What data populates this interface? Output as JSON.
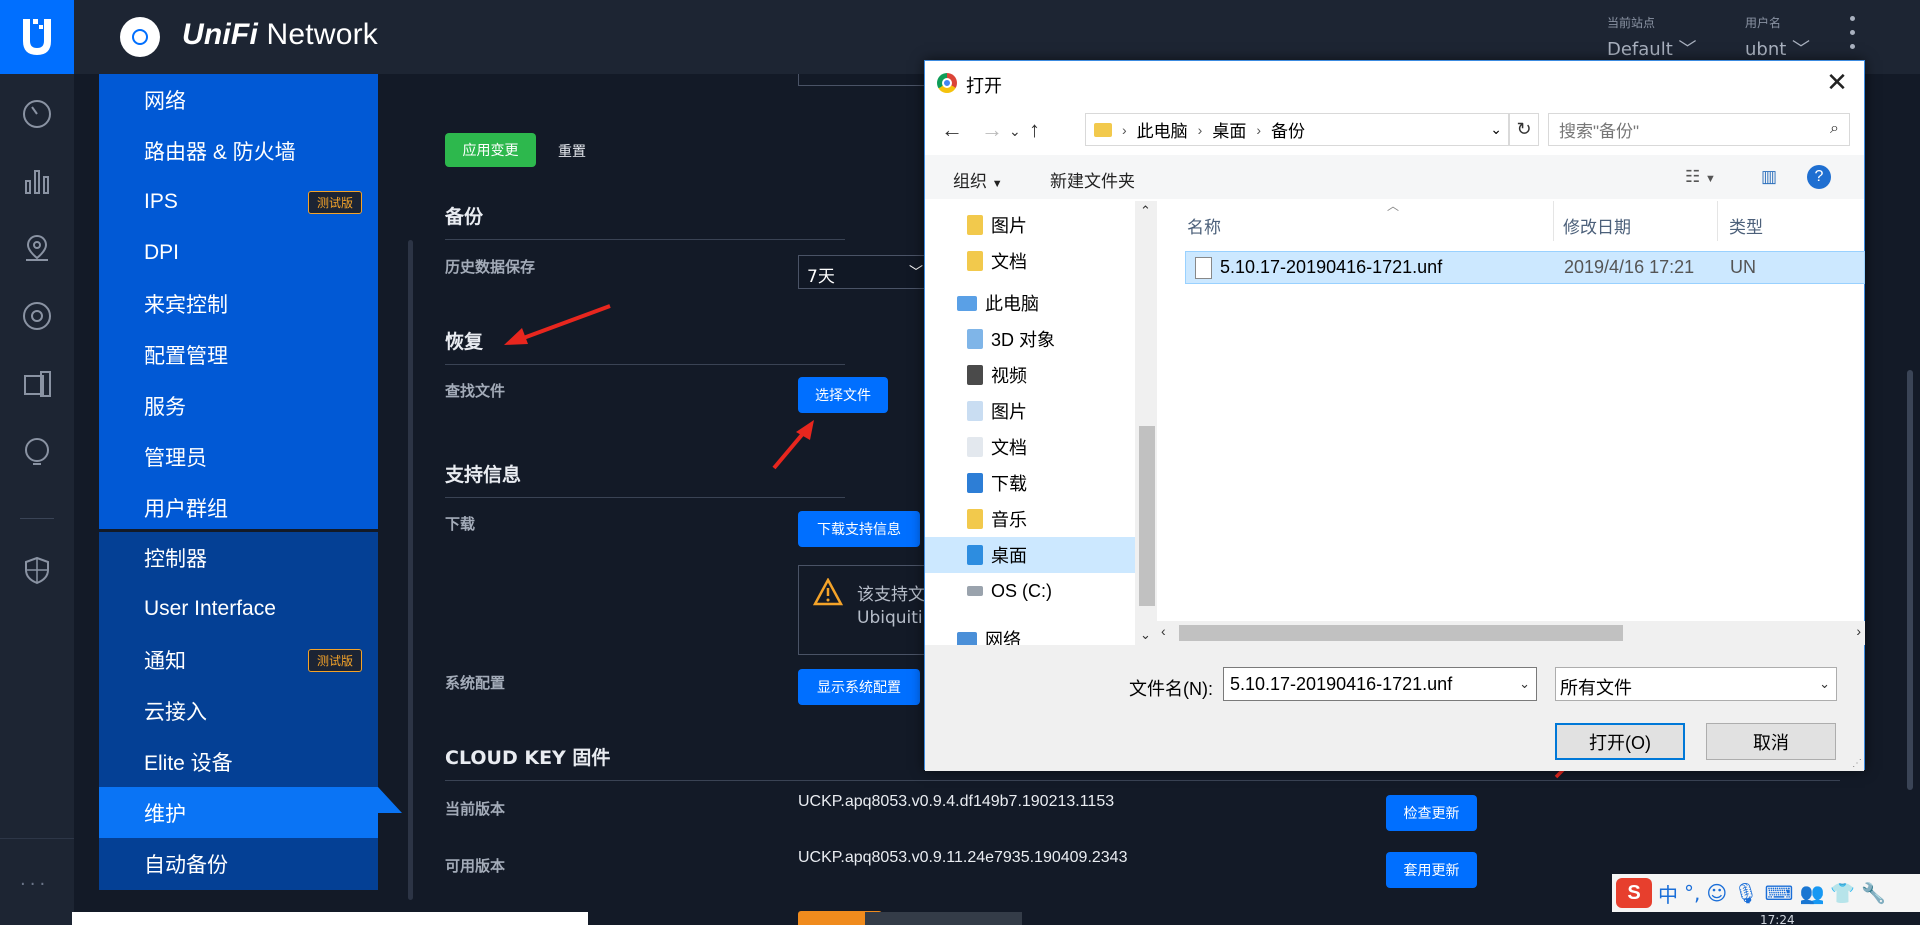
{
  "app": {
    "title_prefix": "UniFi",
    "title_suffix": "Network",
    "site_label": "当前站点",
    "site_value": "Default",
    "user_label": "用户名",
    "user_value": "ubnt"
  },
  "rail_icons": [
    "dashboard-icon",
    "statistics-icon",
    "map-icon",
    "devices-icon",
    "clients-icon",
    "insights-icon",
    "threat-management-icon"
  ],
  "sidenav": {
    "group1": [
      {
        "label": "网络"
      },
      {
        "label": "路由器 & 防火墙"
      },
      {
        "label": "IPS",
        "badge": "测试版"
      },
      {
        "label": "DPI"
      },
      {
        "label": "来宾控制"
      },
      {
        "label": "配置管理"
      },
      {
        "label": "服务"
      },
      {
        "label": "管理员"
      },
      {
        "label": "用户群组"
      }
    ],
    "group2": [
      {
        "label": "控制器"
      },
      {
        "label": "User Interface"
      },
      {
        "label": "通知",
        "badge": "测试版"
      },
      {
        "label": "云接入"
      },
      {
        "label": "Elite 设备"
      },
      {
        "label": "维护",
        "active": true
      },
      {
        "label": "自动备份"
      }
    ]
  },
  "main": {
    "apply_button": "应用变更",
    "reset_link": "重置",
    "backup_title": "备份",
    "history_label": "历史数据保存",
    "history_value": "7天",
    "restore_title": "恢复",
    "find_file_label": "查找文件",
    "choose_file_button": "选择文件",
    "support_title": "支持信息",
    "download_label": "下载",
    "download_button": "下载支持信息",
    "warning_line1": "该支持文",
    "warning_line2": "Ubiquiti",
    "sysconfig_label": "系统配置",
    "sysconfig_button": "显示系统配置",
    "cloudkey_title": "CLOUD KEY 固件",
    "current_version_label": "当前版本",
    "current_version_value": "UCKP.apq8053.v0.9.4.df149b7.190213.1153",
    "check_update_button": "检查更新",
    "available_version_label": "可用版本",
    "available_version_value": "UCKP.apq8053.v0.9.11.24e7935.190409.2343",
    "apply_update_button": "套用更新"
  },
  "dialog": {
    "title": "打开",
    "breadcrumb": [
      "此电脑",
      "桌面",
      "备份"
    ],
    "search_placeholder": "搜索\"备份\"",
    "toolbar_organize": "组织",
    "toolbar_new_folder": "新建文件夹",
    "tree": [
      {
        "label": "图片",
        "icon": "folder-icon"
      },
      {
        "label": "文档",
        "icon": "folder-icon"
      },
      {
        "label": "此电脑",
        "icon": "computer-icon"
      },
      {
        "label": "3D 对象",
        "icon": "3d-objects-icon"
      },
      {
        "label": "视频",
        "icon": "videos-icon"
      },
      {
        "label": "图片",
        "icon": "pictures-icon"
      },
      {
        "label": "文档",
        "icon": "documents-icon"
      },
      {
        "label": "下载",
        "icon": "downloads-icon"
      },
      {
        "label": "音乐",
        "icon": "music-icon"
      },
      {
        "label": "桌面",
        "icon": "desktop-icon",
        "selected": true
      },
      {
        "label": "OS (C:)",
        "icon": "drive-icon"
      },
      {
        "label": "网络",
        "icon": "network-icon"
      }
    ],
    "columns": [
      "名称",
      "修改日期",
      "类型"
    ],
    "files": [
      {
        "name": "5.10.17-20190416-1721.unf",
        "modified": "2019/4/16 17:21",
        "type": "UN"
      }
    ],
    "filename_label": "文件名(N):",
    "filename_value": "5.10.17-20190416-1721.unf",
    "filetype_value": "所有文件",
    "open_button": "打开(O)",
    "cancel_button": "取消"
  },
  "taskbar": {
    "ime_logo": "S",
    "ime_mode": "中",
    "time_fragment": "17:24"
  },
  "colors": {
    "accent": "#006fff",
    "nav_primary": "#0159d5",
    "nav_secondary": "#044095",
    "apply_green": "#2db84d",
    "badge": "#f4a329",
    "arrow_red": "#e8261e"
  }
}
